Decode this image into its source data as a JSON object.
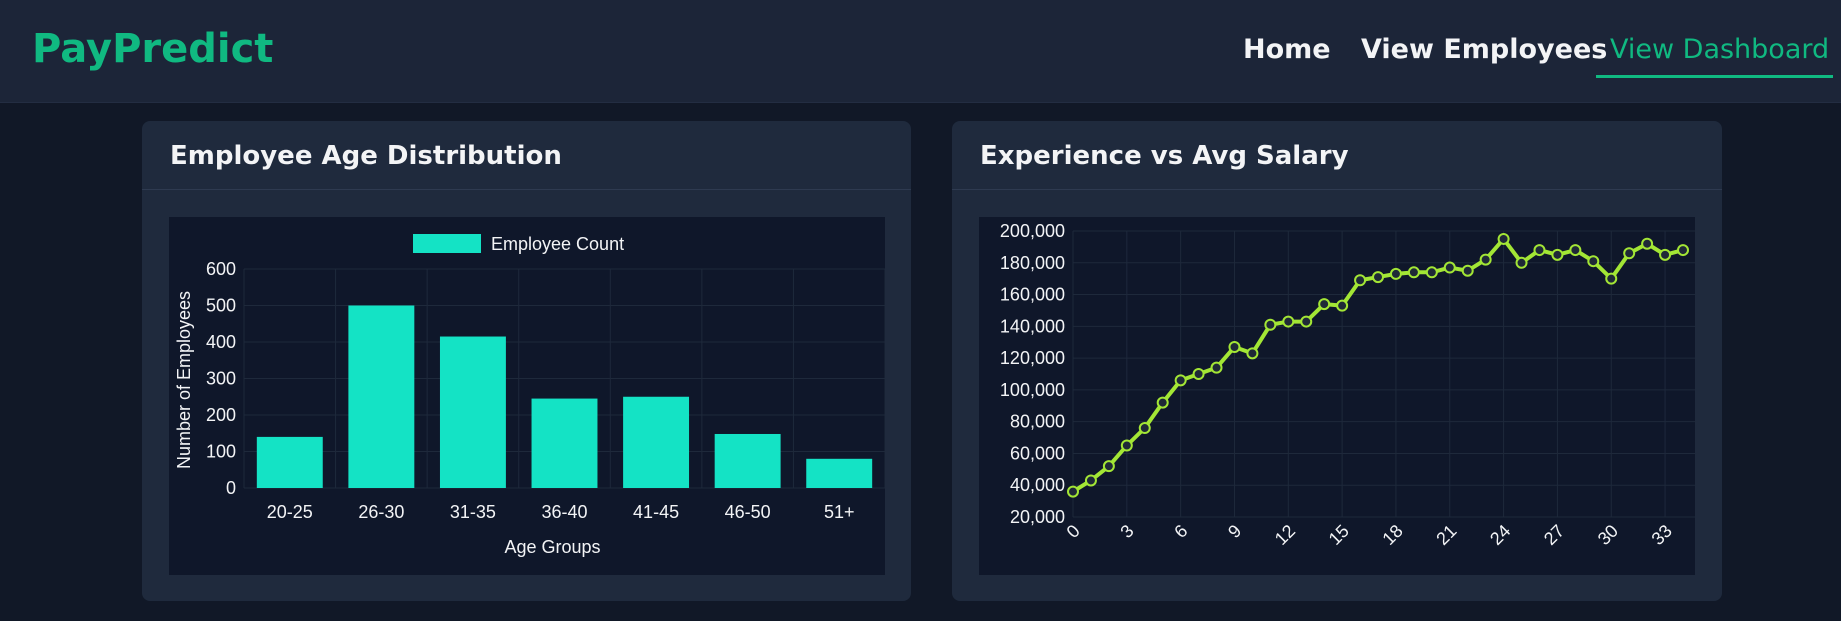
{
  "nav": {
    "brand": "PayPredict",
    "links": [
      "Home",
      "View Employees",
      "View Dashboard"
    ],
    "active": "View Dashboard",
    "accent_color": "#10b981"
  },
  "cards": {
    "age": {
      "title": "Employee Age Distribution"
    },
    "salary": {
      "title": "Experience vs Avg Salary"
    }
  },
  "chart_data": [
    {
      "type": "bar",
      "title": "Employee Age Distribution",
      "legend": "Employee Count",
      "legend_position": "top",
      "categories": [
        "20-25",
        "26-30",
        "31-35",
        "36-40",
        "41-45",
        "46-50",
        "51+"
      ],
      "values": [
        140,
        500,
        415,
        245,
        250,
        148,
        80
      ],
      "xlabel": "Age Groups",
      "ylabel": "Number of Employees",
      "ylim": [
        0,
        600
      ],
      "yticks": [
        "0",
        "100",
        "200",
        "300",
        "400",
        "500",
        "600"
      ],
      "color": "#14e3c5",
      "grid": true
    },
    {
      "type": "line",
      "title": "Experience vs Avg Salary",
      "x": [
        0,
        1,
        2,
        3,
        4,
        5,
        6,
        7,
        8,
        9,
        10,
        11,
        12,
        13,
        14,
        15,
        16,
        17,
        18,
        19,
        20,
        21,
        22,
        23,
        24,
        25,
        26,
        27,
        28,
        29,
        30,
        31,
        32,
        33,
        34
      ],
      "values": [
        36000,
        43000,
        52000,
        65000,
        76000,
        92000,
        106000,
        110000,
        114000,
        127000,
        123000,
        141000,
        143000,
        143000,
        154000,
        153000,
        169000,
        171000,
        173000,
        174000,
        174000,
        177000,
        175000,
        182000,
        195000,
        180000,
        188000,
        185000,
        188000,
        181000,
        170000,
        186000,
        192000,
        185000,
        188000
      ],
      "xticks": [
        "0",
        "3",
        "6",
        "9",
        "12",
        "15",
        "18",
        "21",
        "24",
        "27",
        "30",
        "33"
      ],
      "yticks": [
        "20,000",
        "40,000",
        "60,000",
        "80,000",
        "100,000",
        "120,000",
        "140,000",
        "160,000",
        "180,000",
        "200,000"
      ],
      "ylim": [
        20000,
        200000
      ],
      "color": "#a3e635",
      "grid": true
    }
  ]
}
